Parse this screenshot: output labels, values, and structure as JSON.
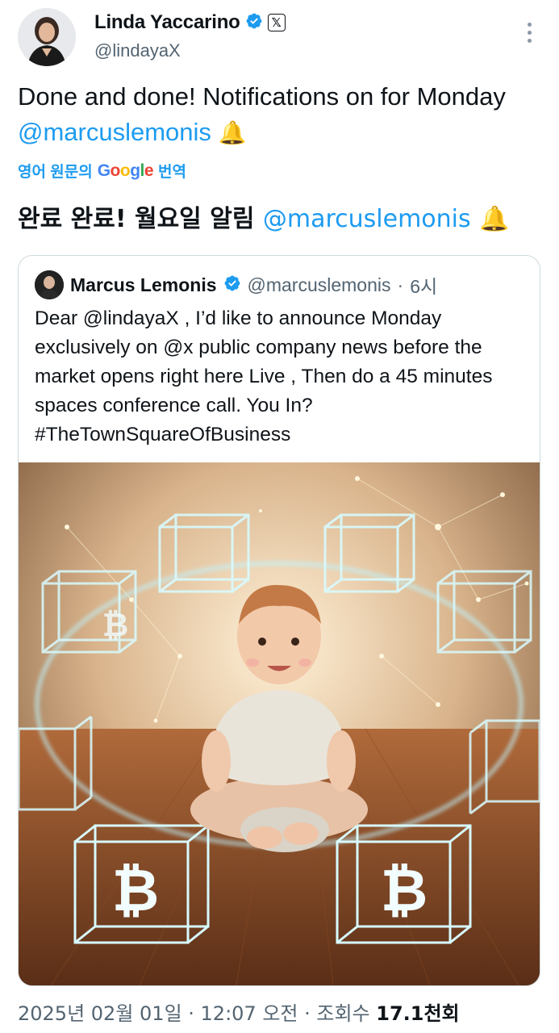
{
  "author": {
    "name": "Linda Yaccarino",
    "handle": "@lindayaX"
  },
  "tweet": {
    "text_prefix": "Done and done!  Notifications on for Monday ",
    "mention": "@marcuslemonis",
    "emoji": "🔔"
  },
  "translation": {
    "label_prefix": "영어 원문의",
    "label_suffix": "번역",
    "google_letters": [
      "G",
      "o",
      "o",
      "g",
      "l",
      "e"
    ],
    "text_prefix": "완료 완료! 월요일 알림 ",
    "mention": "@marcuslemonis",
    "emoji": "🔔"
  },
  "quoted": {
    "name": "Marcus Lemonis",
    "handle": "@marcuslemonis",
    "separator": "·",
    "time": "6시",
    "body": "Dear @lindayaX , I’d like to announce Monday exclusively on @x public company news before the market opens right here Live , Then do a 45 minutes spaces conference call. You In? #TheTownSquareOfBusiness"
  },
  "footer": {
    "timestamp": "2025년 02월 01일 · 12:07 오전 · 조회수 ",
    "views": "17.1천회"
  },
  "colors": {
    "link": "#1d9bf0",
    "text": "#0f1419",
    "muted": "#536471",
    "verified": "#1d9bf0"
  },
  "icons": {
    "verified": "verified-badge-icon",
    "x_badge": "x-logo-icon",
    "more": "more-vertical-icon",
    "bitcoin": "bitcoin-icon"
  }
}
